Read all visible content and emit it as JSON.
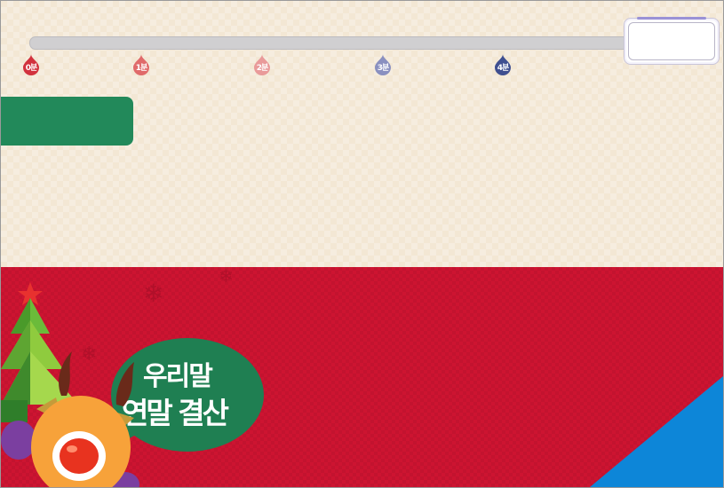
{
  "progress": {
    "markers": [
      {
        "label": "0분",
        "color": "#d2323e"
      },
      {
        "label": "1분",
        "color": "#e06a6a"
      },
      {
        "label": "2분",
        "color": "#e99a9a"
      },
      {
        "label": "3분",
        "color": "#8a90c0"
      },
      {
        "label": "4분",
        "color": "#3f4f90"
      }
    ]
  },
  "timer": {
    "value": ""
  },
  "banner": {
    "title_line1": "우리말",
    "title_line2": "연말 결산"
  },
  "colors": {
    "beige_bg": "#f3e7d4",
    "red_bg": "#cd1431",
    "green_tab": "#22895a",
    "bubble_green": "#1f7f52",
    "blue_corner": "#0d86d8"
  },
  "icons": [
    "marker-pin-icon",
    "christmas-tree-icon",
    "reindeer-icon",
    "snowflake-icon"
  ]
}
